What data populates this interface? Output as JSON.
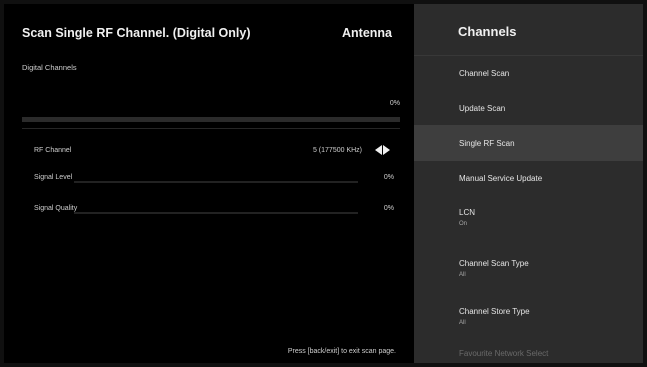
{
  "scan": {
    "title": "Scan Single RF Channel. (Digital Only)",
    "source": "Antenna",
    "section_label": "Digital Channels",
    "progress_percent_text": "0%",
    "progress_fraction": 0,
    "rows": [
      {
        "label": "RF Channel",
        "value": "5 (177500 KHz)"
      },
      {
        "label": "Signal Level",
        "value": "0%",
        "level_fraction": 0
      },
      {
        "label": "Signal Quality",
        "value": "0%",
        "level_fraction": 0
      }
    ],
    "footer_hint": "Press [back/exit] to exit scan page."
  },
  "menu": {
    "title": "Channels",
    "selected_index": 2,
    "items": [
      {
        "label": "Channel Scan",
        "sub": ""
      },
      {
        "label": "Update Scan",
        "sub": ""
      },
      {
        "label": "Single RF Scan",
        "sub": ""
      },
      {
        "label": "Manual Service Update",
        "sub": ""
      },
      {
        "label": "LCN",
        "sub": "On"
      },
      {
        "label": "Channel Scan Type",
        "sub": "All"
      },
      {
        "label": "Channel Store Type",
        "sub": "All"
      },
      {
        "label": "Favourite Network Select",
        "sub": ""
      }
    ]
  },
  "icons": {
    "rf_left": "arrow-left-icon",
    "rf_right": "arrow-right-icon"
  }
}
